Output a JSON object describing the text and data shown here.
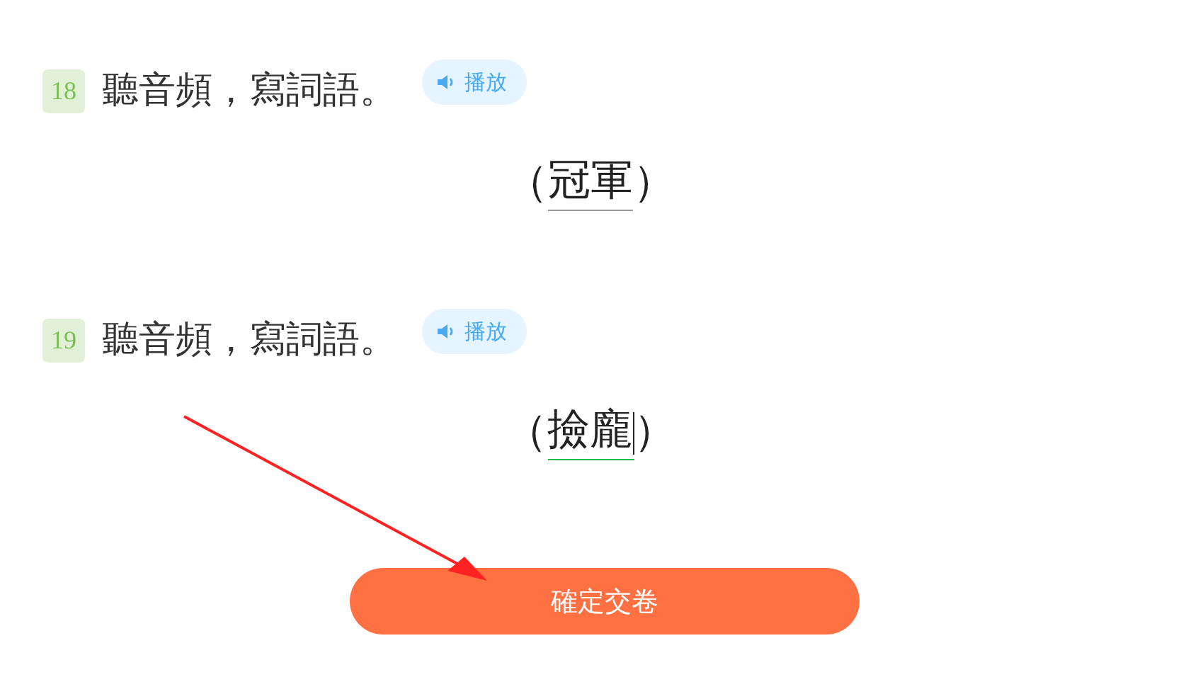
{
  "questions": [
    {
      "number": "18",
      "prompt": "聽音頻，寫詞語。",
      "play_label": "播放",
      "answer": {
        "open": "（",
        "value": "冠軍",
        "close": "）",
        "focused": false
      }
    },
    {
      "number": "19",
      "prompt": "聽音頻，寫詞語。",
      "play_label": "播放",
      "answer": {
        "open": "（",
        "value": "撿龐",
        "close": "）",
        "focused": true
      }
    }
  ],
  "submit_button": "確定交卷",
  "annotation": {
    "kind": "arrow"
  }
}
